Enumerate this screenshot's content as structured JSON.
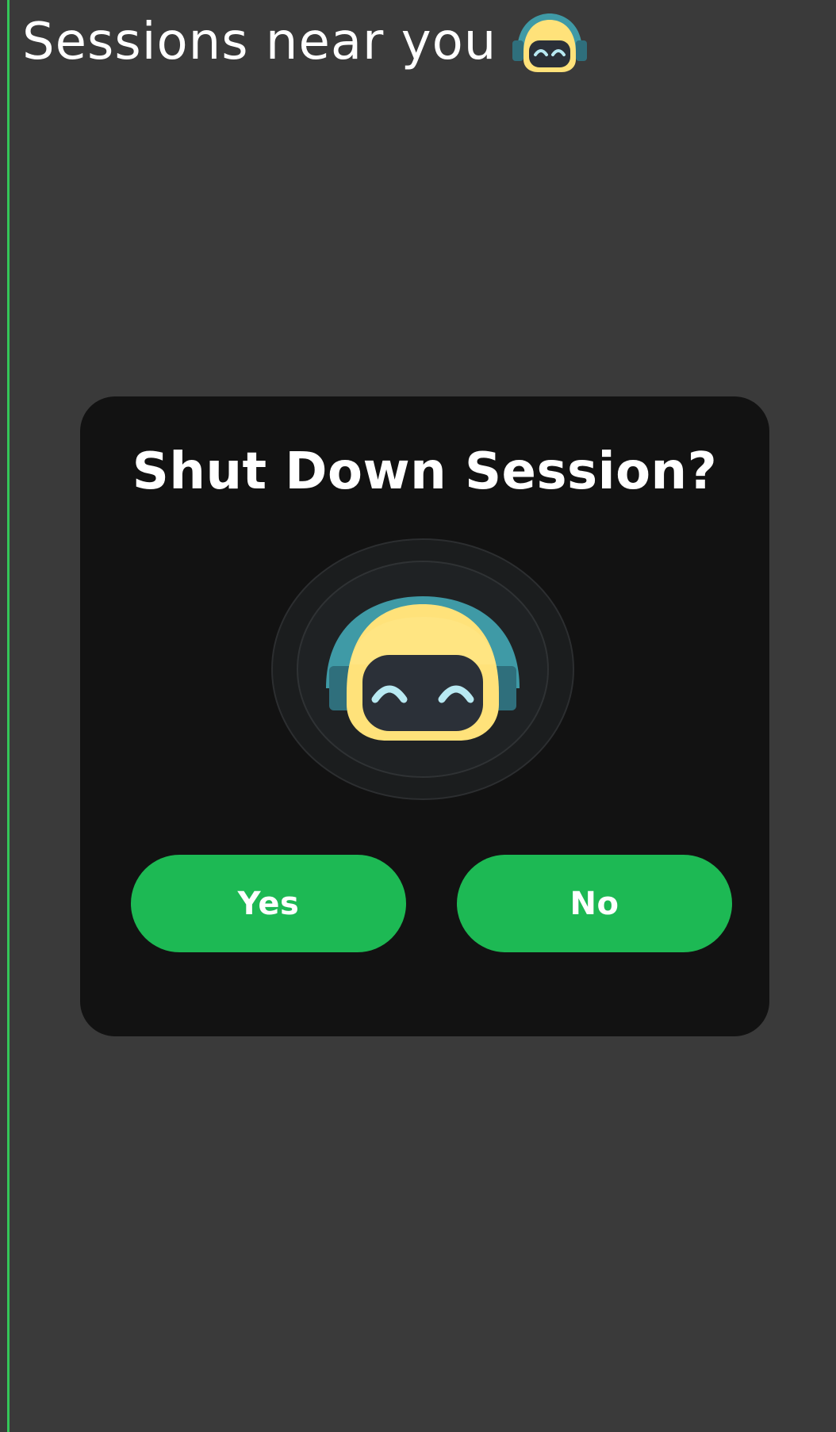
{
  "header": {
    "title": "Sessions near you",
    "mascot_icon": "robot-mascot-icon"
  },
  "dialog": {
    "title": "Shut Down Session?",
    "mascot_icon": "robot-mascot-icon",
    "yes_label": "Yes",
    "no_label": "No"
  },
  "colors": {
    "background": "#3a3a3a",
    "modal_background": "#121212",
    "accent_green": "#1db954",
    "edge_green": "#34c759",
    "mascot_helmet": "#ffe27a",
    "mascot_helmet_back": "#3f9aa6",
    "mascot_visor": "#2b3038",
    "mascot_eyes": "#b8e9f2"
  }
}
